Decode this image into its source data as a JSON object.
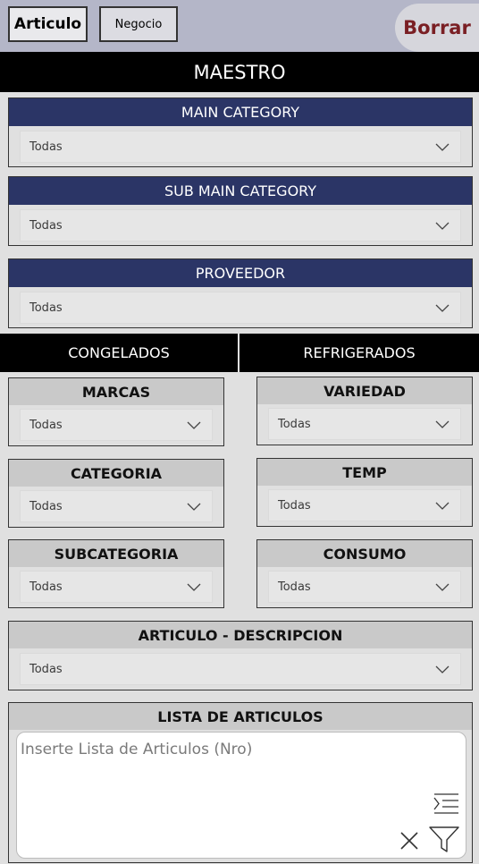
{
  "topbar": {
    "tab_articulo": "Articulo",
    "tab_negocio": "Negocio",
    "borrar_label": "Borrar"
  },
  "maestro": {
    "title": "MAESTRO",
    "filters": [
      {
        "label": "MAIN CATEGORY",
        "value": "Todas"
      },
      {
        "label": "SUB MAIN CATEGORY",
        "value": "Todas"
      },
      {
        "label": "PROVEEDOR",
        "value": "Todas"
      }
    ]
  },
  "congelados": {
    "title": "CONGELADOS",
    "filters": [
      {
        "label": "MARCAS",
        "value": "Todas"
      },
      {
        "label": "CATEGORIA",
        "value": "Todas"
      },
      {
        "label": "SUBCATEGORIA",
        "value": "Todas"
      }
    ]
  },
  "refrigerados": {
    "title": "REFRIGERADOS",
    "filters": [
      {
        "label": "VARIEDAD",
        "value": "Todas"
      },
      {
        "label": "TEMP",
        "value": "Todas"
      },
      {
        "label": "CONSUMO",
        "value": "Todas"
      }
    ]
  },
  "articulo_descripcion": {
    "label": "ARTICULO - DESCRIPCION",
    "value": "Todas"
  },
  "lista": {
    "title": "LISTA DE ARTICULOS",
    "placeholder": "Inserte Lista de Articulos (Nro)"
  },
  "icons": {
    "chevron": "chevron-down-icon",
    "indent": "indent-icon",
    "clear": "close-icon",
    "filter": "filter-icon"
  },
  "colors": {
    "topbar_bg": "#b4b6c8",
    "blue_header": "#2b3566",
    "borrar_text": "#7a1f24",
    "black_header": "#000000"
  }
}
